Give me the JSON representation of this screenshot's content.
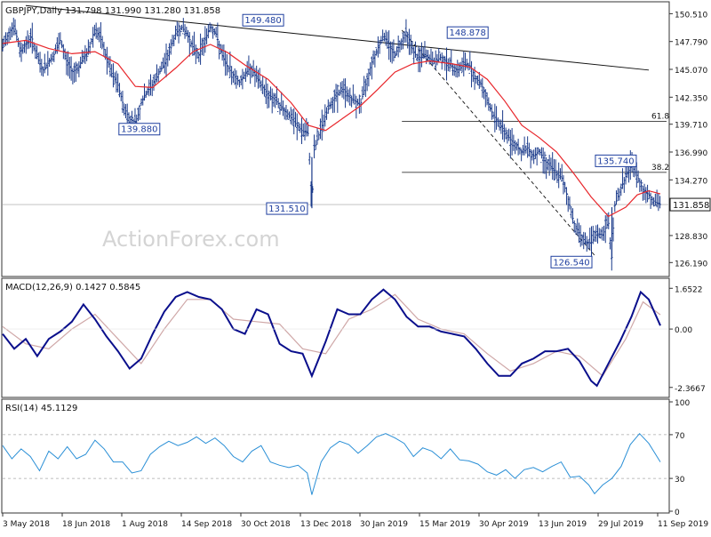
{
  "chart_data": {
    "type": "line",
    "title": "GBPJPY,Daily  131.798 131.990 131.280 131.858",
    "watermark": "ActionForex.com",
    "x_tick_labels": [
      "3 May 2018",
      "18 Jun 2018",
      "1 Aug 2018",
      "14 Sep 2018",
      "30 Oct 2018",
      "13 Dec 2018",
      "30 Jan 2019",
      "15 Mar 2019",
      "30 Apr 2019",
      "13 Jun 2019",
      "29 Jul 2019",
      "11 Sep 2019"
    ],
    "price_panel": {
      "ylim": [
        125.0,
        151.5
      ],
      "y_ticks": [
        "150.510",
        "147.790",
        "145.070",
        "142.350",
        "139.710",
        "136.990",
        "134.270",
        "131.858",
        "128.830",
        "126.190"
      ],
      "last_price": "131.858",
      "price_series_kind": "ohlc-bars",
      "price_color": "#1a3a8a",
      "price_close": [
        [
          0,
          147.2
        ],
        [
          5,
          148.6
        ],
        [
          10,
          149.4
        ],
        [
          15,
          146.8
        ],
        [
          20,
          147.5
        ],
        [
          25,
          148.3
        ],
        [
          30,
          146.2
        ],
        [
          35,
          145.0
        ],
        [
          40,
          145.8
        ],
        [
          45,
          146.6
        ],
        [
          50,
          147.9
        ],
        [
          55,
          146.0
        ],
        [
          60,
          144.8
        ],
        [
          65,
          145.2
        ],
        [
          70,
          146.1
        ],
        [
          75,
          147.0
        ],
        [
          80,
          149.1
        ],
        [
          85,
          148.0
        ],
        [
          90,
          146.2
        ],
        [
          95,
          144.5
        ],
        [
          100,
          143.5
        ],
        [
          105,
          141.4
        ],
        [
          110,
          140.2
        ],
        [
          115,
          139.9
        ],
        [
          118,
          140.8
        ],
        [
          120,
          141.8
        ],
        [
          125,
          142.8
        ],
        [
          130,
          143.6
        ],
        [
          135,
          144.6
        ],
        [
          140,
          145.6
        ],
        [
          145,
          146.9
        ],
        [
          150,
          148.6
        ],
        [
          155,
          149.2
        ],
        [
          160,
          148.5
        ],
        [
          165,
          147.2
        ],
        [
          170,
          146.5
        ],
        [
          175,
          147.8
        ],
        [
          180,
          149.3
        ],
        [
          185,
          148.5
        ],
        [
          190,
          146.5
        ],
        [
          195,
          145.3
        ],
        [
          200,
          144.5
        ],
        [
          205,
          143.8
        ],
        [
          210,
          144.6
        ],
        [
          215,
          145.3
        ],
        [
          220,
          144.2
        ],
        [
          225,
          143.4
        ],
        [
          230,
          142.6
        ],
        [
          235,
          142.2
        ],
        [
          240,
          141.6
        ],
        [
          245,
          141.0
        ],
        [
          250,
          140.3
        ],
        [
          255,
          139.6
        ],
        [
          260,
          139.0
        ],
        [
          265,
          138.8
        ],
        [
          268,
          131.5
        ],
        [
          270,
          137.2
        ],
        [
          275,
          139.0
        ],
        [
          280,
          140.6
        ],
        [
          285,
          141.9
        ],
        [
          290,
          142.6
        ],
        [
          295,
          143.2
        ],
        [
          300,
          142.4
        ],
        [
          305,
          142.0
        ],
        [
          310,
          141.6
        ],
        [
          315,
          143.8
        ],
        [
          320,
          145.8
        ],
        [
          325,
          147.1
        ],
        [
          330,
          148.4
        ],
        [
          335,
          147.5
        ],
        [
          340,
          146.5
        ],
        [
          345,
          147.7
        ],
        [
          350,
          148.8
        ],
        [
          355,
          147.1
        ],
        [
          360,
          146.0
        ],
        [
          365,
          146.6
        ],
        [
          370,
          146.1
        ],
        [
          375,
          145.8
        ],
        [
          380,
          146.3
        ],
        [
          385,
          145.7
        ],
        [
          390,
          145.3
        ],
        [
          395,
          145.0
        ],
        [
          400,
          145.6
        ],
        [
          405,
          145.4
        ],
        [
          410,
          144.2
        ],
        [
          415,
          143.6
        ],
        [
          420,
          142.0
        ],
        [
          425,
          140.6
        ],
        [
          430,
          139.9
        ],
        [
          435,
          139.0
        ],
        [
          440,
          138.2
        ],
        [
          445,
          137.7
        ],
        [
          450,
          136.9
        ],
        [
          455,
          137.4
        ],
        [
          460,
          136.6
        ],
        [
          465,
          137.1
        ],
        [
          470,
          136.1
        ],
        [
          475,
          135.6
        ],
        [
          480,
          134.9
        ],
        [
          485,
          134.4
        ],
        [
          490,
          132.4
        ],
        [
          495,
          130.1
        ],
        [
          500,
          129.0
        ],
        [
          505,
          128.2
        ],
        [
          510,
          128.1
        ],
        [
          515,
          129.0
        ],
        [
          520,
          128.9
        ],
        [
          525,
          130.2
        ],
        [
          528,
          126.5
        ],
        [
          530,
          131.6
        ],
        [
          535,
          133.2
        ],
        [
          540,
          134.6
        ],
        [
          545,
          135.7
        ],
        [
          550,
          134.6
        ],
        [
          555,
          133.3
        ],
        [
          560,
          132.8
        ],
        [
          565,
          132.1
        ],
        [
          570,
          131.858
        ]
      ],
      "ma_color": "#e8262b",
      "ma": [
        [
          0,
          147.6
        ],
        [
          20,
          147.9
        ],
        [
          40,
          147.1
        ],
        [
          60,
          146.6
        ],
        [
          80,
          146.8
        ],
        [
          100,
          145.6
        ],
        [
          115,
          143.4
        ],
        [
          130,
          143.3
        ],
        [
          150,
          145.2
        ],
        [
          165,
          146.8
        ],
        [
          180,
          147.5
        ],
        [
          195,
          146.7
        ],
        [
          210,
          145.5
        ],
        [
          230,
          144.1
        ],
        [
          250,
          141.8
        ],
        [
          265,
          139.6
        ],
        [
          280,
          139.1
        ],
        [
          295,
          140.3
        ],
        [
          310,
          141.5
        ],
        [
          325,
          143.1
        ],
        [
          340,
          144.8
        ],
        [
          355,
          145.6
        ],
        [
          370,
          145.9
        ],
        [
          390,
          145.6
        ],
        [
          405,
          145.3
        ],
        [
          420,
          144.1
        ],
        [
          435,
          142.0
        ],
        [
          450,
          139.6
        ],
        [
          465,
          138.4
        ],
        [
          480,
          137.0
        ],
        [
          495,
          134.9
        ],
        [
          510,
          132.6
        ],
        [
          525,
          130.7
        ],
        [
          540,
          131.6
        ],
        [
          550,
          132.8
        ],
        [
          560,
          133.2
        ],
        [
          570,
          132.9
        ]
      ],
      "trendline": [
        [
          20,
          151.3
        ],
        [
          560,
          145.0
        ]
      ],
      "dashed_line": [
        [
          346,
          148.9
        ],
        [
          513,
          126.9
        ]
      ],
      "fib_lines": [
        {
          "label": "61.8",
          "y": 140.0,
          "x_start": 346
        },
        {
          "label": "38.2",
          "y": 135.0,
          "x_start": 346
        }
      ],
      "current_price_line": 131.858,
      "annotations": [
        {
          "text": "149.480",
          "x": 168,
          "y": 149.48
        },
        {
          "text": "139.880",
          "x": 110,
          "y": 139.88
        },
        {
          "text": "131.510",
          "x": 268,
          "y": 131.51
        },
        {
          "text": "148.878",
          "x": 346,
          "y": 148.878
        },
        {
          "text": "126.540",
          "x": 513,
          "y": 126.54
        },
        {
          "text": "135.740",
          "x": 553,
          "y": 135.74
        }
      ]
    },
    "macd_panel": {
      "label": "MACD(12,26,9)  0.1427  0.5845",
      "ylim": [
        -2.7,
        1.95
      ],
      "y_ticks": [
        "1.6522",
        "0.00",
        "-2.3667"
      ],
      "macd_color": "#0a0f8c",
      "signal_color": "#cfa7a7",
      "macd": [
        [
          0,
          -0.2
        ],
        [
          10,
          -0.8
        ],
        [
          20,
          -0.4
        ],
        [
          30,
          -1.1
        ],
        [
          40,
          -0.4
        ],
        [
          50,
          -0.1
        ],
        [
          60,
          0.3
        ],
        [
          70,
          1.0
        ],
        [
          80,
          0.4
        ],
        [
          90,
          -0.3
        ],
        [
          100,
          -0.9
        ],
        [
          110,
          -1.6
        ],
        [
          120,
          -1.2
        ],
        [
          130,
          -0.2
        ],
        [
          140,
          0.7
        ],
        [
          150,
          1.3
        ],
        [
          160,
          1.5
        ],
        [
          170,
          1.3
        ],
        [
          180,
          1.2
        ],
        [
          190,
          0.8
        ],
        [
          200,
          0.0
        ],
        [
          210,
          -0.2
        ],
        [
          220,
          0.8
        ],
        [
          230,
          0.6
        ],
        [
          240,
          -0.6
        ],
        [
          250,
          -0.9
        ],
        [
          260,
          -1.0
        ],
        [
          268,
          -1.9
        ],
        [
          280,
          -0.5
        ],
        [
          290,
          0.8
        ],
        [
          300,
          0.6
        ],
        [
          310,
          0.6
        ],
        [
          320,
          1.2
        ],
        [
          330,
          1.6
        ],
        [
          340,
          1.2
        ],
        [
          350,
          0.5
        ],
        [
          360,
          0.1
        ],
        [
          370,
          0.1
        ],
        [
          380,
          -0.1
        ],
        [
          390,
          -0.2
        ],
        [
          400,
          -0.3
        ],
        [
          410,
          -0.8
        ],
        [
          420,
          -1.4
        ],
        [
          430,
          -1.9
        ],
        [
          440,
          -1.9
        ],
        [
          450,
          -1.4
        ],
        [
          460,
          -1.2
        ],
        [
          470,
          -0.9
        ],
        [
          480,
          -0.9
        ],
        [
          490,
          -0.8
        ],
        [
          500,
          -1.3
        ],
        [
          510,
          -2.1
        ],
        [
          515,
          -2.3
        ],
        [
          525,
          -1.4
        ],
        [
          535,
          -0.5
        ],
        [
          545,
          0.5
        ],
        [
          553,
          1.5
        ],
        [
          560,
          1.2
        ],
        [
          570,
          0.14
        ]
      ],
      "signal": [
        [
          0,
          0.1
        ],
        [
          20,
          -0.6
        ],
        [
          40,
          -0.8
        ],
        [
          60,
          0.0
        ],
        [
          80,
          0.6
        ],
        [
          100,
          -0.4
        ],
        [
          120,
          -1.4
        ],
        [
          140,
          0.0
        ],
        [
          160,
          1.2
        ],
        [
          180,
          1.2
        ],
        [
          200,
          0.4
        ],
        [
          220,
          0.3
        ],
        [
          240,
          0.2
        ],
        [
          260,
          -0.8
        ],
        [
          280,
          -1.0
        ],
        [
          300,
          0.4
        ],
        [
          320,
          0.8
        ],
        [
          340,
          1.4
        ],
        [
          360,
          0.4
        ],
        [
          380,
          0.0
        ],
        [
          400,
          -0.2
        ],
        [
          420,
          -1.0
        ],
        [
          440,
          -1.7
        ],
        [
          460,
          -1.4
        ],
        [
          480,
          -0.9
        ],
        [
          500,
          -1.1
        ],
        [
          520,
          -1.9
        ],
        [
          540,
          -0.4
        ],
        [
          555,
          1.1
        ],
        [
          570,
          0.58
        ]
      ]
    },
    "rsi_panel": {
      "label": "RSI(14)  45.1129",
      "ylim": [
        0,
        100
      ],
      "y_ticks": [
        "100",
        "70",
        "30",
        "0"
      ],
      "rsi_color": "#2a8fd6",
      "levels": [
        70,
        30
      ],
      "rsi": [
        [
          0,
          60
        ],
        [
          8,
          48
        ],
        [
          16,
          57
        ],
        [
          24,
          50
        ],
        [
          32,
          37
        ],
        [
          40,
          55
        ],
        [
          48,
          48
        ],
        [
          56,
          59
        ],
        [
          64,
          48
        ],
        [
          72,
          52
        ],
        [
          80,
          65
        ],
        [
          88,
          57
        ],
        [
          96,
          45
        ],
        [
          104,
          45
        ],
        [
          112,
          35
        ],
        [
          120,
          37
        ],
        [
          128,
          52
        ],
        [
          136,
          59
        ],
        [
          144,
          64
        ],
        [
          152,
          60
        ],
        [
          160,
          63
        ],
        [
          168,
          68
        ],
        [
          176,
          62
        ],
        [
          184,
          67
        ],
        [
          192,
          60
        ],
        [
          200,
          50
        ],
        [
          208,
          45
        ],
        [
          216,
          55
        ],
        [
          224,
          60
        ],
        [
          232,
          45
        ],
        [
          240,
          42
        ],
        [
          248,
          40
        ],
        [
          256,
          42
        ],
        [
          264,
          35
        ],
        [
          268,
          15
        ],
        [
          276,
          45
        ],
        [
          284,
          58
        ],
        [
          292,
          64
        ],
        [
          300,
          61
        ],
        [
          308,
          53
        ],
        [
          316,
          60
        ],
        [
          324,
          68
        ],
        [
          332,
          71
        ],
        [
          340,
          67
        ],
        [
          348,
          62
        ],
        [
          356,
          50
        ],
        [
          364,
          58
        ],
        [
          372,
          55
        ],
        [
          380,
          48
        ],
        [
          388,
          57
        ],
        [
          396,
          47
        ],
        [
          404,
          46
        ],
        [
          412,
          43
        ],
        [
          420,
          36
        ],
        [
          428,
          33
        ],
        [
          436,
          38
        ],
        [
          444,
          30
        ],
        [
          452,
          38
        ],
        [
          460,
          40
        ],
        [
          468,
          36
        ],
        [
          476,
          41
        ],
        [
          484,
          45
        ],
        [
          492,
          31
        ],
        [
          500,
          32
        ],
        [
          508,
          24
        ],
        [
          513,
          16
        ],
        [
          520,
          24
        ],
        [
          528,
          30
        ],
        [
          536,
          41
        ],
        [
          544,
          61
        ],
        [
          552,
          71
        ],
        [
          560,
          62
        ],
        [
          570,
          45
        ]
      ]
    }
  }
}
